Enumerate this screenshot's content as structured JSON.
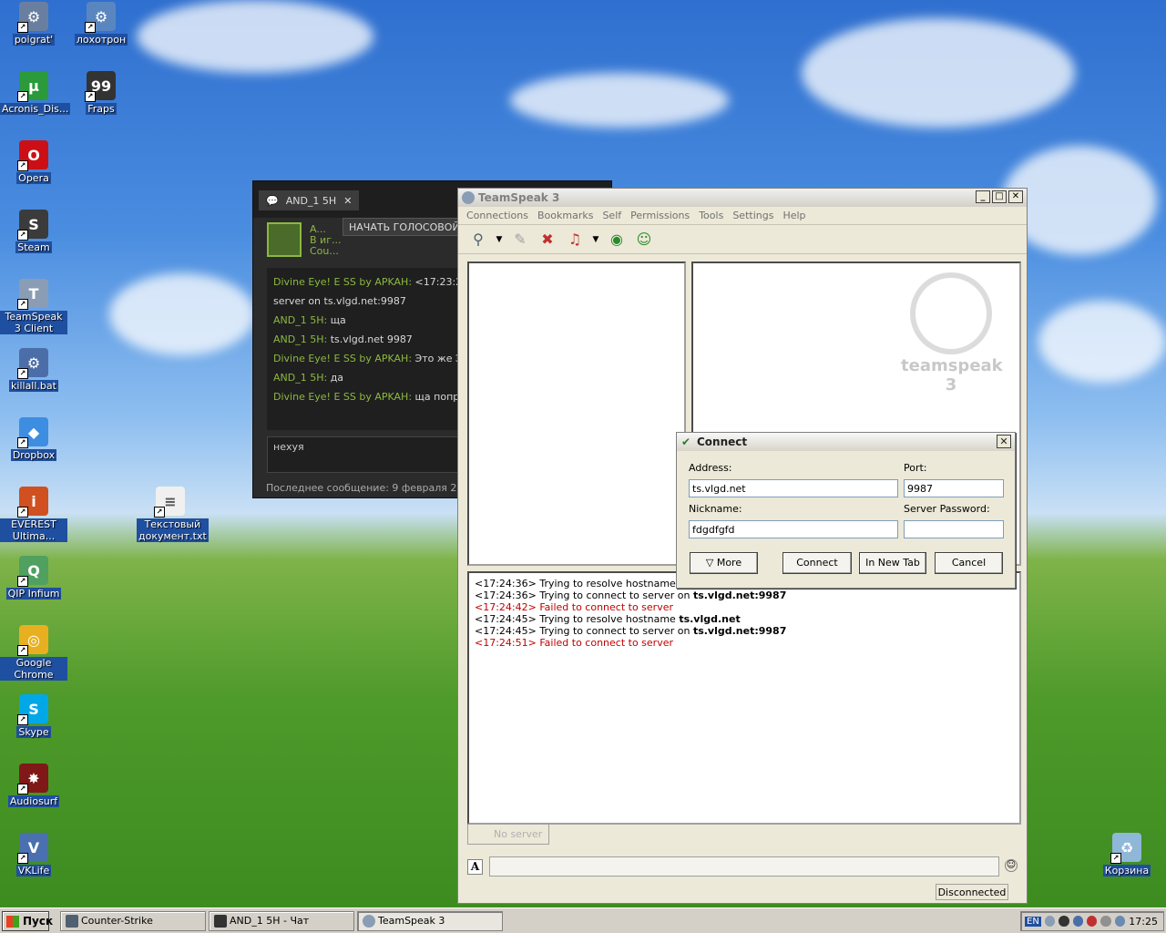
{
  "desktop": {
    "icons": [
      {
        "label": "poigrat'",
        "color": "#6a7fa0",
        "glyph": "⚙"
      },
      {
        "label": "лохотрон",
        "color": "#5a86c0",
        "glyph": "⚙"
      },
      {
        "label": "Acronis_Dis...",
        "color": "#2a9a3a",
        "glyph": "µ"
      },
      {
        "label": "Fraps",
        "color": "#333333",
        "glyph": "99"
      },
      {
        "label": "Opera",
        "color": "#cc0f16",
        "glyph": "O"
      },
      {
        "label": "Steam",
        "color": "#3b3b3b",
        "glyph": "S"
      },
      {
        "label": "TeamSpeak 3 Client",
        "color": "#8a9db5",
        "glyph": "T"
      },
      {
        "label": "killall.bat",
        "color": "#4c6ea8",
        "glyph": "⚙"
      },
      {
        "label": "Dropbox",
        "color": "#3d8de0",
        "glyph": "◆"
      },
      {
        "label": "EVEREST Ultima...",
        "color": "#d05020",
        "glyph": "i"
      },
      {
        "label": "QIP Infium",
        "color": "#50a060",
        "glyph": "Q"
      },
      {
        "label": "Google Chrome",
        "color": "#e8b020",
        "glyph": "◎"
      },
      {
        "label": "Skype",
        "color": "#00a8e8",
        "glyph": "S"
      },
      {
        "label": "Audiosurf",
        "color": "#801818",
        "glyph": "✸"
      },
      {
        "label": "VKLife",
        "color": "#4a70b0",
        "glyph": "V"
      },
      {
        "label": "Текстовый документ.txt",
        "color": "#f0f0f0",
        "glyph": "≡"
      },
      {
        "label": "Корзина",
        "color": "#8fb7d8",
        "glyph": "♻"
      }
    ]
  },
  "steam_chat": {
    "tab_label": "AND_1 5H",
    "tab_close": "✕",
    "user_short": "A...",
    "user_status": "В иг...",
    "user_game": "Cou...",
    "voice_button": "НАЧАТЬ ГОЛОСОВОЙ ЧАТ",
    "messages": [
      {
        "name": "Divine Eye! E SS by APKAH:",
        "text": " <17:23:23> Ti"
      },
      {
        "name": "",
        "text": "server on ts.vlgd.net:9987"
      },
      {
        "name": "AND_1 5H:",
        "text": " ща"
      },
      {
        "name": "AND_1 5H:",
        "text": " ts.vlgd.net 9987"
      },
      {
        "name": "Divine Eye! E SS by APKAH:",
        "text": " Это же Эй то"
      },
      {
        "name": "AND_1 5H:",
        "text": " да"
      },
      {
        "name": "Divine Eye! E SS by APKAH:",
        "text": " ща попробую"
      }
    ],
    "input_value": "нехуя",
    "last_message": "Последнее сообщение: 9 февраля 2011 г."
  },
  "teamspeak": {
    "title": "TeamSpeak 3",
    "window_buttons": [
      "_",
      "□",
      "✕"
    ],
    "menu": [
      "Connections",
      "Bookmarks",
      "Self",
      "Permissions",
      "Tools",
      "Settings",
      "Help"
    ],
    "logo_text": "teamspeak 3",
    "log": [
      {
        "time": "<17:24:36>",
        "text": "Trying to resolve hostname ",
        "bold": "ts.vl",
        "error": false
      },
      {
        "time": "<17:24:36>",
        "text": "Trying to connect to server on ",
        "bold": "ts.vlgd.net:9987",
        "error": false
      },
      {
        "time": "<17:24:42>",
        "text": "Failed to connect to server",
        "bold": "",
        "error": true
      },
      {
        "time": "<17:24:45>",
        "text": "Trying to resolve hostname ",
        "bold": "ts.vlgd.net",
        "error": false
      },
      {
        "time": "<17:24:45>",
        "text": "Trying to connect to server on ",
        "bold": "ts.vlgd.net:9987",
        "error": false
      },
      {
        "time": "<17:24:51>",
        "text": "Failed to connect to server",
        "bold": "",
        "error": true
      }
    ],
    "server_tab": "No server",
    "status": "Disconnected"
  },
  "connect_dialog": {
    "title": "Connect",
    "close": "✕",
    "address_label": "Address:",
    "address_value": "ts.vlgd.net",
    "port_label": "Port:",
    "port_value": "9987",
    "nickname_label": "Nickname:",
    "nickname_value": "fdgdfgfd",
    "password_label": "Server Password:",
    "password_value": "",
    "more_button": "▽ More",
    "connect_button": "Connect",
    "new_tab_button": "In New Tab",
    "cancel_button": "Cancel"
  },
  "taskbar": {
    "start": "Пуск",
    "tasks": [
      {
        "label": "Counter-Strike",
        "color": "#506070"
      },
      {
        "label": "AND_1 5H - Чат",
        "color": "#333333"
      },
      {
        "label": "TeamSpeak 3",
        "color": "#8a9db5"
      }
    ],
    "lang": "EN",
    "clock": "17:25"
  }
}
